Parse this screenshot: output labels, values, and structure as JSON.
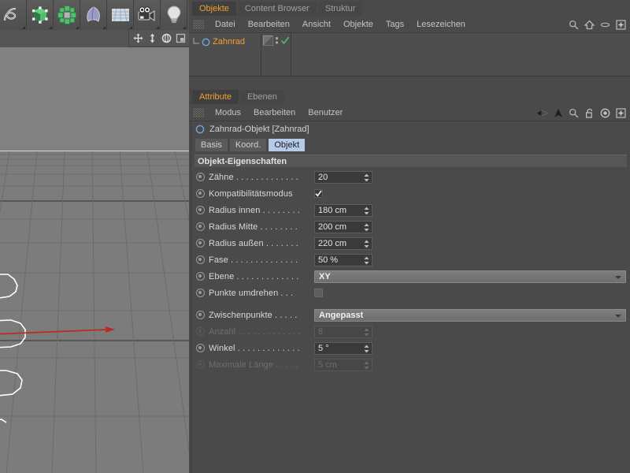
{
  "app": {
    "accent_orange": "#f0a030",
    "tab_active_bg": "#b6cbe8",
    "panel_bg": "#4a4a4a",
    "viewport_bg": "#7c7c7c",
    "axis_x_color": "#c03028",
    "spline_color": "#ffffff"
  },
  "toolbar": {
    "buttons": [
      {
        "name": "spline-tool",
        "label": "Spline"
      },
      {
        "name": "cube-primitive",
        "label": "Würfel"
      },
      {
        "name": "generator",
        "label": "Generator"
      },
      {
        "name": "deformer",
        "label": "Deformer"
      },
      {
        "name": "floor-scene",
        "label": "Boden"
      },
      {
        "name": "camera",
        "label": "Kamera"
      },
      {
        "name": "light",
        "label": "Licht"
      }
    ]
  },
  "viewport_nav": {
    "buttons": [
      {
        "name": "pan-view",
        "label": "Verschieben"
      },
      {
        "name": "dolly-view",
        "label": "Zoomen"
      },
      {
        "name": "rotate-view",
        "label": "Drehen"
      },
      {
        "name": "maximize-view",
        "label": "Ansicht maximieren"
      }
    ]
  },
  "object_manager": {
    "tabs": [
      {
        "label": "Objekte",
        "active": true
      },
      {
        "label": "Content Browser",
        "active": false
      },
      {
        "label": "Struktur",
        "active": false
      }
    ],
    "menu": [
      "Datei",
      "Bearbeiten",
      "Ansicht",
      "Objekte",
      "Tags",
      "Lesezeichen"
    ],
    "icons": [
      "search-icon",
      "home-icon",
      "eye-icon",
      "plus-box-icon"
    ],
    "objects": [
      {
        "name": "Zahnrad",
        "icon": "spline-circle-icon",
        "visible": true
      }
    ]
  },
  "attribute_manager": {
    "tabs": [
      {
        "label": "Attribute",
        "active": true
      },
      {
        "label": "Ebenen",
        "active": false
      }
    ],
    "menu": [
      "Modus",
      "Bearbeiten",
      "Benutzer"
    ],
    "icons": [
      "back-arrow-icon",
      "forward-arrow-icon",
      "up-arrow-icon",
      "search-icon",
      "lock-open-icon",
      "target-icon",
      "plus-box-icon"
    ],
    "title": "Zahnrad-Objekt [Zahnrad]",
    "object_tabs": [
      {
        "label": "Basis",
        "active": false
      },
      {
        "label": "Koord.",
        "active": false
      },
      {
        "label": "Objekt",
        "active": true
      }
    ],
    "group_header": "Objekt-Eigenschaften",
    "properties": [
      {
        "label": "Zähne",
        "dots": ". . . . . . . . . . . . .",
        "type": "number",
        "value": "20",
        "enabled": true
      },
      {
        "label": "Kompatibilitätsmodus",
        "dots": "",
        "type": "checkbox",
        "value": "checked",
        "enabled": true
      },
      {
        "label": "Radius innen",
        "dots": ". . . . . . . .",
        "type": "number",
        "value": "180 cm",
        "enabled": true
      },
      {
        "label": "Radius Mitte",
        "dots": ". . . . . . . .",
        "type": "number",
        "value": "200 cm",
        "enabled": true
      },
      {
        "label": "Radius außen",
        "dots": ". . . . . . .",
        "type": "number",
        "value": "220 cm",
        "enabled": true
      },
      {
        "label": "Fase",
        "dots": ". . . . . . . . . . . . . .",
        "type": "number",
        "value": "50 %",
        "enabled": true
      },
      {
        "label": "Ebene",
        "dots": ". . . . . . . . . . . . .",
        "type": "dropdown",
        "value": "XY",
        "enabled": true
      },
      {
        "label": "Punkte umdrehen",
        "dots": ". . .",
        "type": "checkbox",
        "value": "unchecked",
        "enabled": true
      },
      {
        "label": "Zwischenpunkte",
        "dots": ". . . . .",
        "type": "dropdown",
        "value": "Angepasst",
        "enabled": true
      },
      {
        "label": "Anzahl",
        "dots": ". . . . . . . . . . . . .",
        "type": "number",
        "value": "8",
        "enabled": false
      },
      {
        "label": "Winkel",
        "dots": ". . . . . . . . . . . . .",
        "type": "number",
        "value": "5 °",
        "enabled": true
      },
      {
        "label": "Maximale Länge",
        "dots": ". . . . .",
        "type": "number",
        "value": "5 cm",
        "enabled": false
      }
    ]
  }
}
